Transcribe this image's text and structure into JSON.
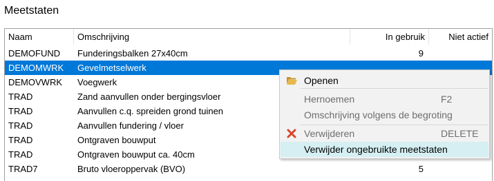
{
  "panel": {
    "title": "Meetstaten"
  },
  "table": {
    "columns": [
      "Naam",
      "Omschrijving",
      "In gebruik",
      "Niet actief"
    ],
    "rows": [
      {
        "name": "DEMOFUND",
        "desc": "Funderingsbalken 27x40cm",
        "in_use": "9",
        "inactive": ""
      },
      {
        "name": "DEMOMWRK",
        "desc": "Gevelmetselwerk",
        "in_use": "",
        "inactive": ""
      },
      {
        "name": "DEMOVWRK",
        "desc": "Voegwerk",
        "in_use": "",
        "inactive": ""
      },
      {
        "name": "TRAD",
        "desc": "Zand aanvullen onder bergingsvloer",
        "in_use": "",
        "inactive": ""
      },
      {
        "name": "TRAD",
        "desc": "Aanvullen c.q. spreiden grond tuinen",
        "in_use": "",
        "inactive": ""
      },
      {
        "name": "TRAD",
        "desc": "Aanvullen fundering / vloer",
        "in_use": "",
        "inactive": ""
      },
      {
        "name": "TRAD",
        "desc": "Ontgraven bouwput",
        "in_use": "",
        "inactive": ""
      },
      {
        "name": "TRAD",
        "desc": "Ontgraven bouwput ca. 40cm",
        "in_use": "",
        "inactive": ""
      },
      {
        "name": "TRAD7",
        "desc": "Bruto vloeroppervak (BVO)",
        "in_use": "5",
        "inactive": ""
      }
    ],
    "selected_index": 1,
    "selection_color": "#0078d7"
  },
  "context_menu": {
    "items": [
      {
        "label": "Openen",
        "shortcut": "",
        "icon": "folder-open-icon",
        "enabled": true
      },
      {
        "label": "Hernoemen",
        "shortcut": "F2",
        "icon": "",
        "enabled": false
      },
      {
        "label": "Omschrijving volgens de begroting",
        "shortcut": "",
        "icon": "",
        "enabled": false
      },
      {
        "label": "Verwijderen",
        "shortcut": "DELETE",
        "icon": "delete-x-icon",
        "enabled": false
      },
      {
        "label": "Verwijder ongebruikte meetstaten",
        "shortcut": "",
        "icon": "",
        "enabled": true
      }
    ],
    "highlight_color": "#d5eff2",
    "delete_icon_color": "#d9462b",
    "folder_icon_color": "#e8b94a"
  }
}
